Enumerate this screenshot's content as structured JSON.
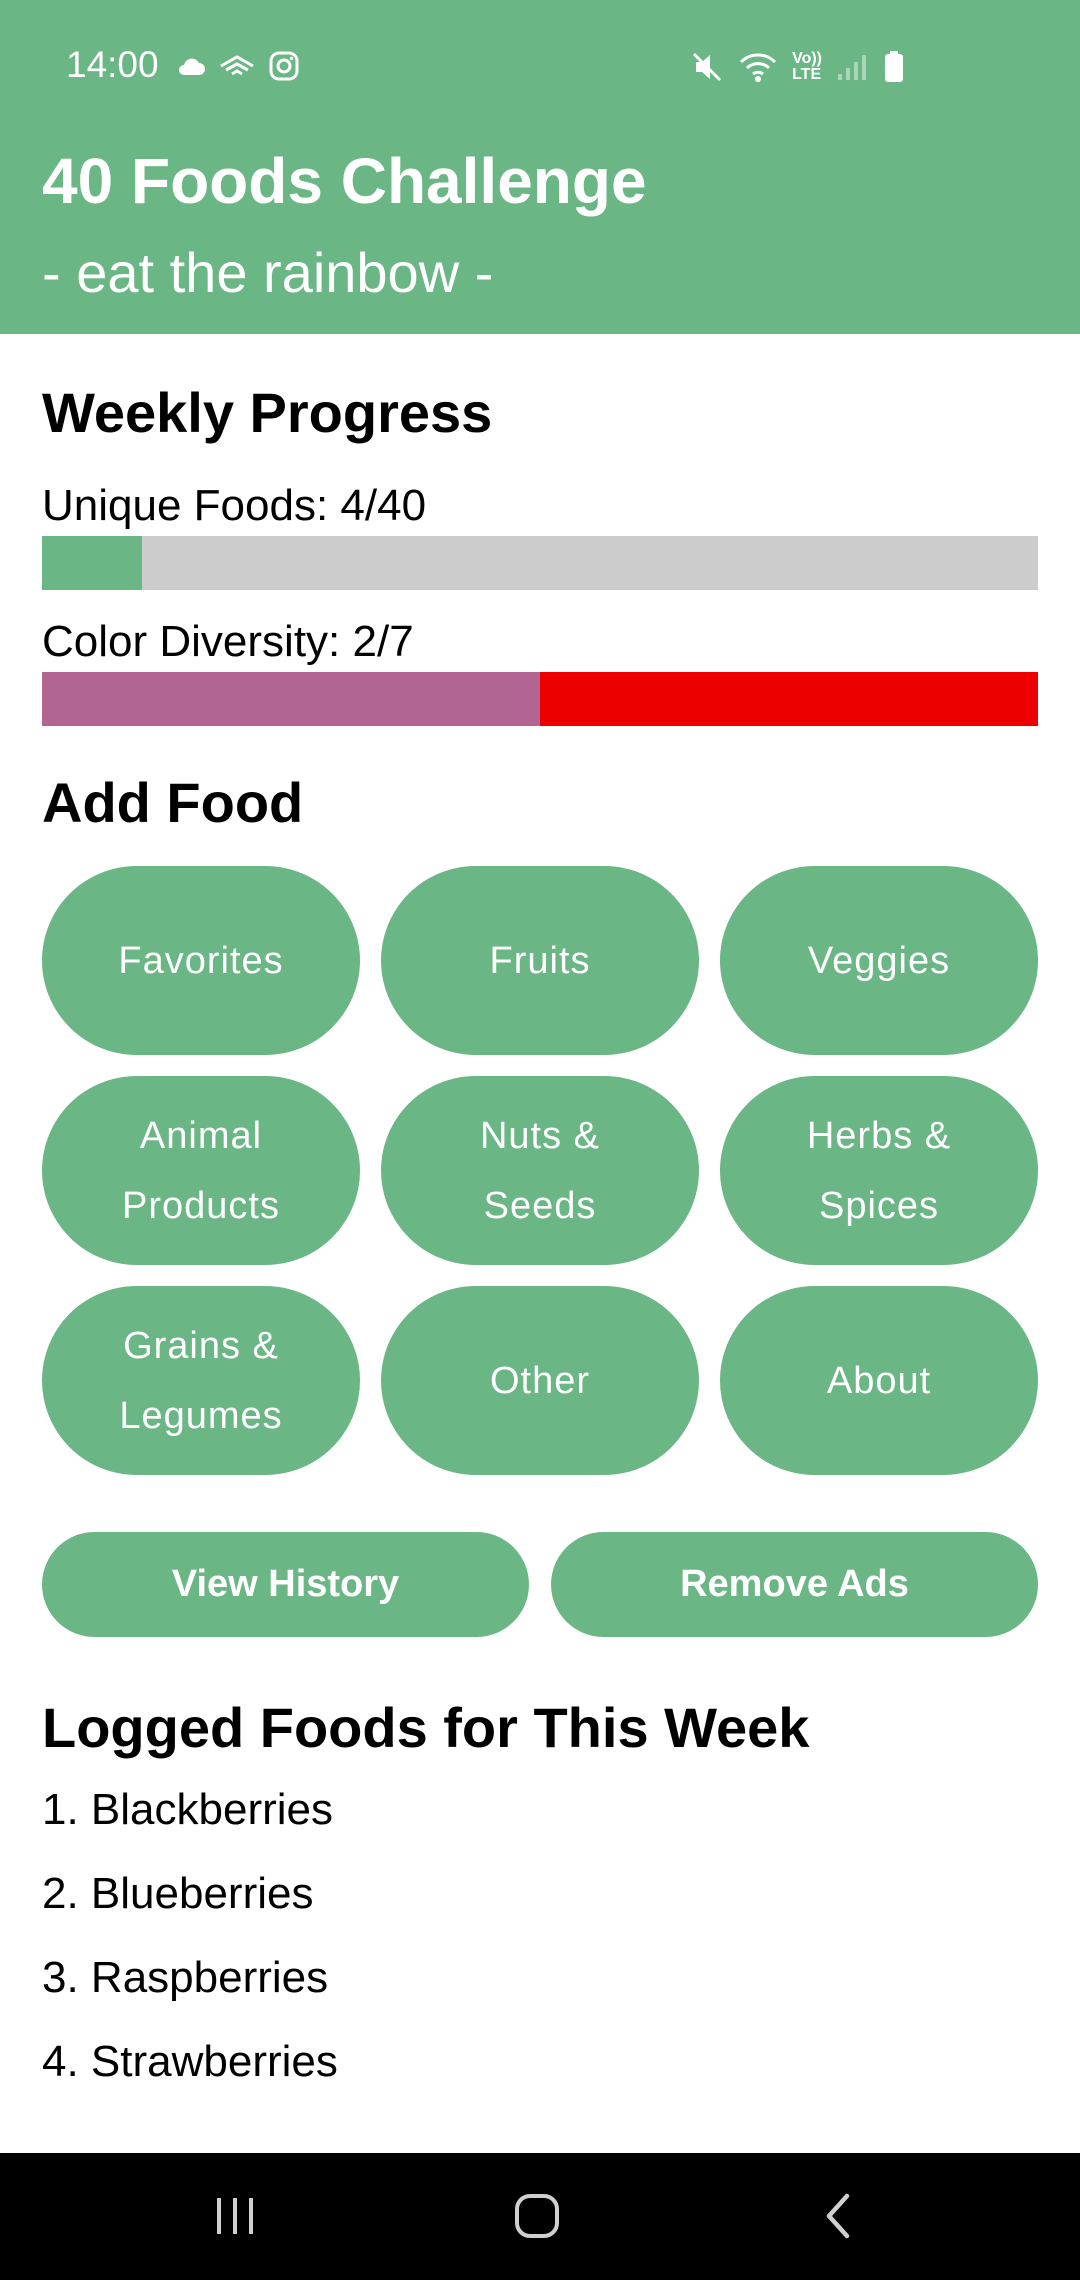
{
  "status_bar": {
    "time": "14:00",
    "left_icons": [
      "cloud-icon",
      "cast-icon",
      "instagram-icon"
    ],
    "right_icons": [
      "mute-icon",
      "wifi-icon",
      "volte-icon",
      "signal-icon",
      "battery-icon"
    ],
    "volte_label_top": "Vo))",
    "volte_label_bottom": "LTE"
  },
  "header": {
    "title": "40 Foods Challenge",
    "subtitle": "- eat the rainbow -",
    "background_color": "#6bb685"
  },
  "weekly_progress": {
    "title": "Weekly Progress",
    "unique_foods": {
      "label": "Unique Foods: 4/40",
      "value": 4,
      "max": 40,
      "fill_color": "#6bb685",
      "track_color": "#cccccc"
    },
    "color_diversity": {
      "label": "Color Diversity: 2/7",
      "value": 2,
      "max": 7,
      "fill_fraction": 0.5,
      "fill_color": "#b26493",
      "track_color": "#ee0000"
    }
  },
  "add_food": {
    "title": "Add Food",
    "categories": [
      {
        "label": "Favorites"
      },
      {
        "label": "Fruits"
      },
      {
        "label": "Veggies"
      },
      {
        "label": "Animal Products"
      },
      {
        "label": "Nuts & Seeds"
      },
      {
        "label": "Herbs & Spices"
      },
      {
        "label": "Grains & Legumes"
      },
      {
        "label": "Other"
      },
      {
        "label": "About"
      }
    ]
  },
  "actions": {
    "view_history": "View History",
    "remove_ads": "Remove Ads"
  },
  "logged_foods": {
    "title": "Logged Foods for This Week",
    "items": [
      "1. Blackberries",
      "2. Blueberries",
      "3. Raspberries",
      "4. Strawberries"
    ]
  },
  "nav_bar": {
    "buttons": [
      "recent-apps-icon",
      "home-icon",
      "back-icon"
    ]
  }
}
